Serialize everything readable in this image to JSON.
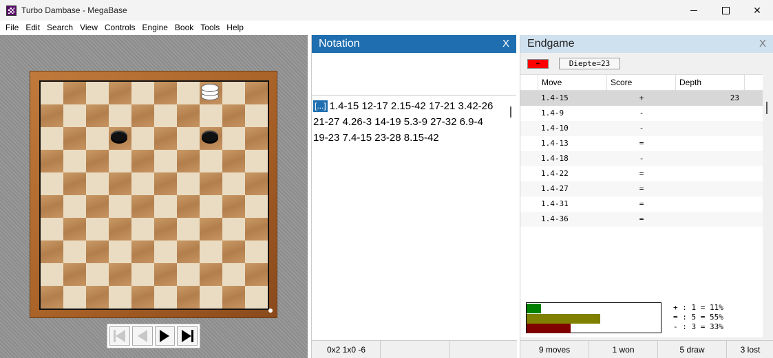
{
  "window": {
    "title": "Turbo Dambase - MegaBase"
  },
  "menu": [
    "File",
    "Edit",
    "Search",
    "View",
    "Controls",
    "Engine",
    "Book",
    "Tools",
    "Help"
  ],
  "notation": {
    "header": "Notation",
    "close": "X",
    "marker": "[...]",
    "line1": "1.4-15 12-17 2.15-42 17-21 3.42-26",
    "line2": "21-27 4.26-3 14-19 5.3-9 27-32 6.9-4",
    "line3": "19-23 7.4-15 23-28 8.15-42",
    "status": [
      "0x2 1x0 -6",
      "",
      ""
    ]
  },
  "endgame": {
    "header": "Endgame",
    "close": "X",
    "plus_button": "+",
    "depth_button": "Diepte=23",
    "columns": [
      "Move",
      "Score",
      "Depth"
    ],
    "rows": [
      {
        "move": "1.4-15",
        "score": "+",
        "depth": "23"
      },
      {
        "move": "1.4-9",
        "score": "-",
        "depth": ""
      },
      {
        "move": "1.4-10",
        "score": "-",
        "depth": ""
      },
      {
        "move": "1.4-13",
        "score": "=",
        "depth": ""
      },
      {
        "move": "1.4-18",
        "score": "-",
        "depth": ""
      },
      {
        "move": "1.4-22",
        "score": "=",
        "depth": ""
      },
      {
        "move": "1.4-27",
        "score": "=",
        "depth": ""
      },
      {
        "move": "1.4-31",
        "score": "=",
        "depth": ""
      },
      {
        "move": "1.4-36",
        "score": "=",
        "depth": ""
      }
    ],
    "legend": [
      "+ : 1 = 11%",
      "= : 5 = 55%",
      "- : 3 = 33%"
    ],
    "graph": [
      {
        "label": "won",
        "fraction": 0.11,
        "color": "#008000"
      },
      {
        "label": "draw",
        "fraction": 0.55,
        "color": "#808000"
      },
      {
        "label": "lost",
        "fraction": 0.33,
        "color": "#800000"
      }
    ],
    "status": [
      "9 moves",
      "1 won",
      "5 draw",
      "3 lost"
    ]
  },
  "colors": {
    "notation_header": "#1f6fb0",
    "endgame_header": "#cfe0ef",
    "plus_button": "#ff0000"
  }
}
